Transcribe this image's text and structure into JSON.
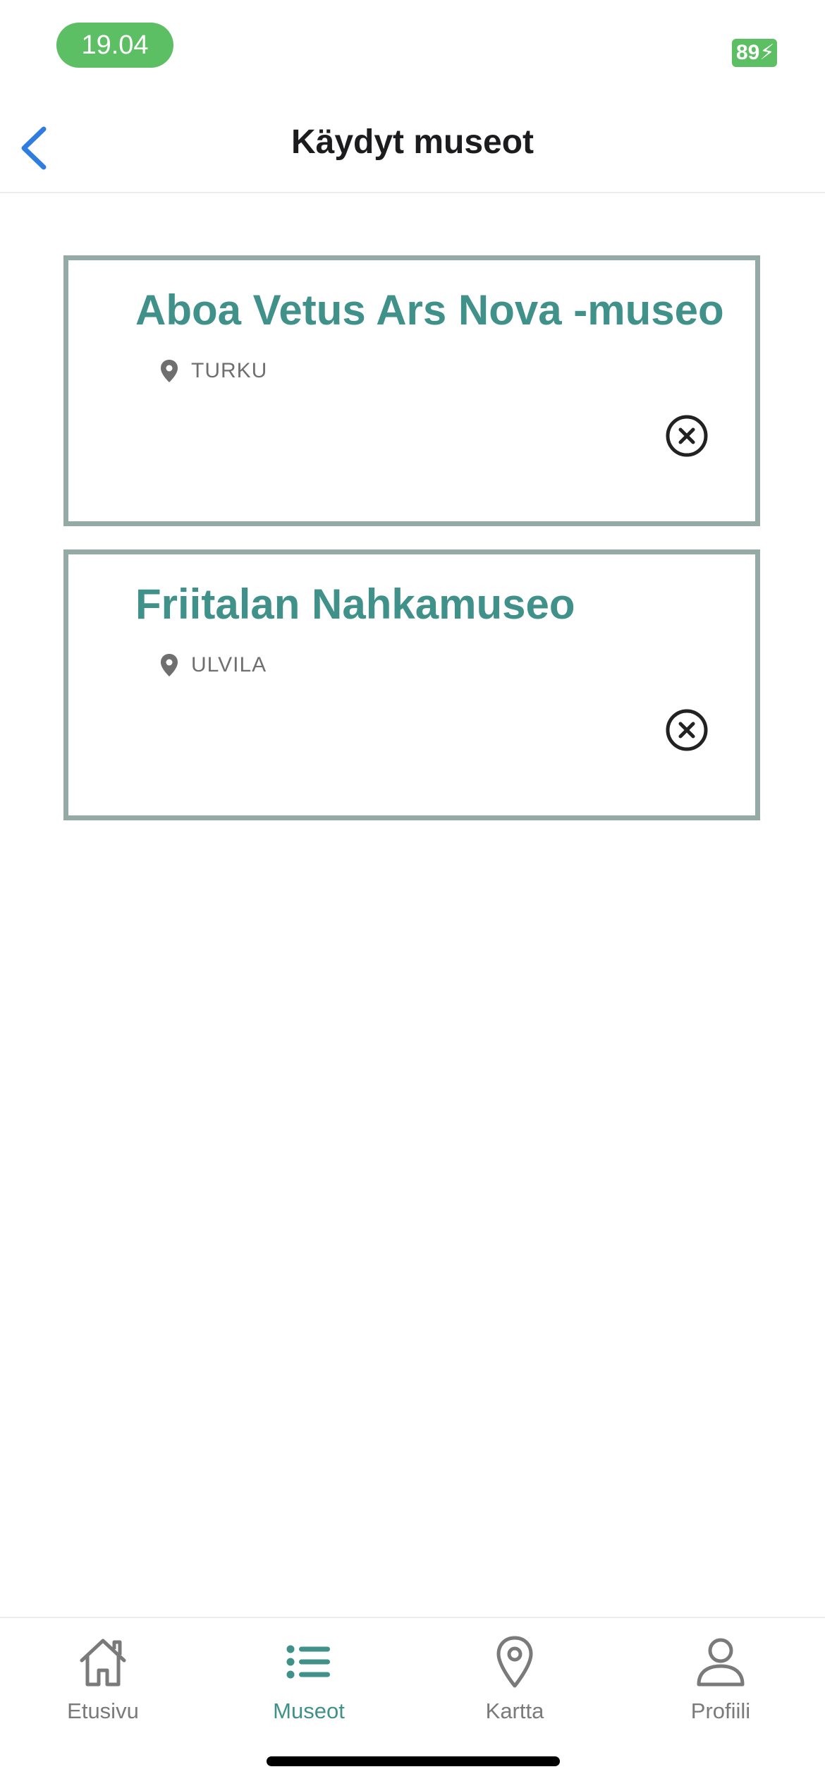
{
  "colors": {
    "accent": "#3f9189",
    "status_green": "#5cbf63",
    "back_blue": "#2f7de1"
  },
  "status_bar": {
    "time": "19.04",
    "battery": "89"
  },
  "header": {
    "back_icon": "chevron-left-icon",
    "title": "Käydyt museot"
  },
  "museums": [
    {
      "name": "Aboa Vetus Ars Nova -museo",
      "location": "TURKU",
      "remove_icon": "close-circle-icon"
    },
    {
      "name": "Friitalan Nahkamuseo",
      "location": "ULVILA",
      "remove_icon": "close-circle-icon"
    }
  ],
  "tab_bar": {
    "active": "Museot",
    "tabs": [
      {
        "label": "Etusivu",
        "icon": "home-icon"
      },
      {
        "label": "Museot",
        "icon": "list-icon"
      },
      {
        "label": "Kartta",
        "icon": "map-pin-icon"
      },
      {
        "label": "Profiili",
        "icon": "user-icon"
      }
    ]
  }
}
